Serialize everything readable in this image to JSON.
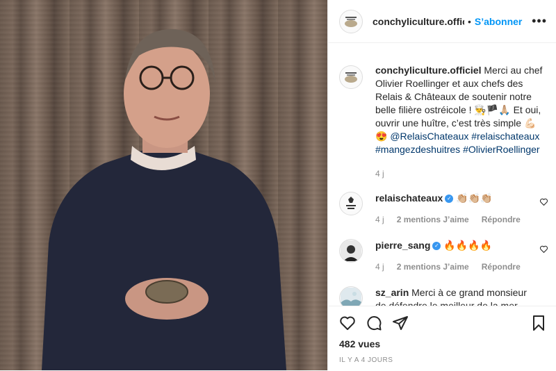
{
  "post": {
    "account": "conchyliculture.offici",
    "separator": "•",
    "follow_label": "S’abonner",
    "more_label": "•••",
    "avatar_text": "ostreiculture"
  },
  "caption": {
    "author": "conchyliculture.officiel",
    "text": " Merci au chef Olivier Roellinger et aux chefs des Relais & Châteaux de soutenir notre belle filière ostréicole ! 👨‍🍳🏴🙏🏼 Et oui, ouvrir une huître, c’est très simple 💪🏻 😍 ",
    "mention": "@RelaisChateaux",
    "hashtags": [
      "#relaischateaux",
      "#mangezdeshuitres",
      "#OlivierRoellinger"
    ],
    "age": "4 j"
  },
  "comments": [
    {
      "author": "relaischateaux",
      "verified": true,
      "text": "👏🏼👏🏼👏🏼",
      "age": "4 j",
      "likes": "2 mentions J’aime",
      "reply": "Répondre",
      "avatar_icon": "relais-chateaux-logo"
    },
    {
      "author": "pierre_sang",
      "verified": true,
      "text": "🔥🔥🔥🔥",
      "age": "4 j",
      "likes": "2 mentions J’aime",
      "reply": "Répondre",
      "avatar_icon": "portrait"
    },
    {
      "author": "sz_arin",
      "verified": false,
      "text": "Merci à ce grand monsieur de défendre le meilleur de la mer",
      "avatar_icon": "landscape"
    }
  ],
  "stats": {
    "views": "482 vues",
    "timestamp": "IL Y A 4 JOURS"
  },
  "icons": [
    "heart-icon",
    "comment-icon",
    "share-icon",
    "save-icon"
  ]
}
